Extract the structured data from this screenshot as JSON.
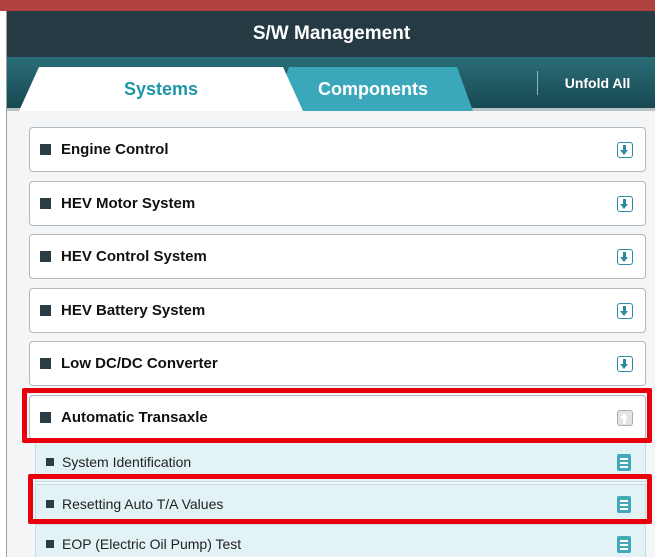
{
  "header": {
    "title": "S/W Management"
  },
  "tabs": [
    {
      "label": "Systems",
      "active": true
    },
    {
      "label": "Components",
      "active": false
    }
  ],
  "toolbar": {
    "unfold_all_label": "Unfold All"
  },
  "groups": [
    {
      "label": "Engine Control",
      "state": "collapsed",
      "icon": "download-icon"
    },
    {
      "label": "HEV Motor System",
      "state": "collapsed",
      "icon": "download-icon"
    },
    {
      "label": "HEV Control System",
      "state": "collapsed",
      "icon": "download-icon"
    },
    {
      "label": "HEV Battery System",
      "state": "collapsed",
      "icon": "download-icon"
    },
    {
      "label": "Low DC/DC Converter",
      "state": "collapsed",
      "icon": "download-icon"
    },
    {
      "label": "Automatic Transaxle",
      "state": "expanded",
      "icon": "collapse-up-icon",
      "highlighted": true
    }
  ],
  "subitems": [
    {
      "label": "System Identification",
      "icon": "document-icon"
    },
    {
      "label": "Resetting Auto T/A Values",
      "icon": "document-icon",
      "highlighted": true
    },
    {
      "label": "EOP (Electric Oil Pump) Test",
      "icon": "document-icon"
    }
  ],
  "colors": {
    "title_bar": "#263a43",
    "tab_bar": "#1f5c66",
    "active_tab_text": "#1e95a8",
    "inactive_tab": "#3aa8ba",
    "highlight": "#e8000d",
    "subitem_bg": "#e3f2f5"
  }
}
